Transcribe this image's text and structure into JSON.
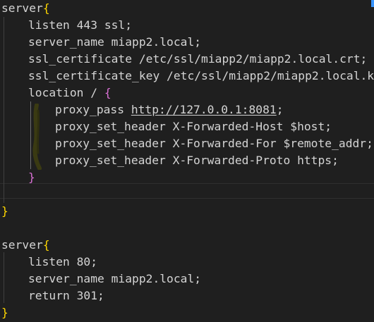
{
  "editor": {
    "lines": [
      {
        "indent": 0,
        "code": "server",
        "brace": "{",
        "brace_color": "yellow"
      },
      {
        "indent": 1,
        "code": "listen 443 ssl;"
      },
      {
        "indent": 1,
        "code": "server_name miapp2.local;"
      },
      {
        "indent": 1,
        "code": "ssl_certificate /etc/ssl/miapp2/miapp2.local.crt;"
      },
      {
        "indent": 1,
        "code": "ssl_certificate_key /etc/ssl/miapp2/miapp2.local.k"
      },
      {
        "indent": 1,
        "code": "location / ",
        "brace": "{",
        "brace_color": "purple"
      },
      {
        "indent": 2,
        "code_before": "proxy_pass ",
        "url": "http://127.0.0.1:8081",
        "code_after": ";"
      },
      {
        "indent": 2,
        "code": "proxy_set_header X-Forwarded-Host $host;"
      },
      {
        "indent": 2,
        "code": "proxy_set_header X-Forwarded-For $remote_addr;"
      },
      {
        "indent": 2,
        "code": "proxy_set_header X-Forwarded-Proto https;"
      },
      {
        "indent": 1,
        "code": "",
        "brace": "}",
        "brace_color": "purple"
      },
      {
        "indent": 0,
        "code": ""
      },
      {
        "indent": 0,
        "code": "",
        "brace": "}",
        "brace_color": "yellow"
      },
      {
        "indent": 0,
        "code": ""
      },
      {
        "indent": 0,
        "code": "server",
        "brace": "{",
        "brace_color": "yellow"
      },
      {
        "indent": 1,
        "code": "listen 80;"
      },
      {
        "indent": 1,
        "code": "server_name miapp2.local;"
      },
      {
        "indent": 1,
        "code": "return 301;"
      },
      {
        "indent": 0,
        "code": "",
        "brace": "}",
        "brace_color": "yellow"
      }
    ]
  },
  "colors": {
    "background": "#1f1f1f",
    "text": "#d4d4d4",
    "brace_yellow": "#ffd700",
    "brace_purple": "#da70d6",
    "annotation": "#3a3a12"
  }
}
